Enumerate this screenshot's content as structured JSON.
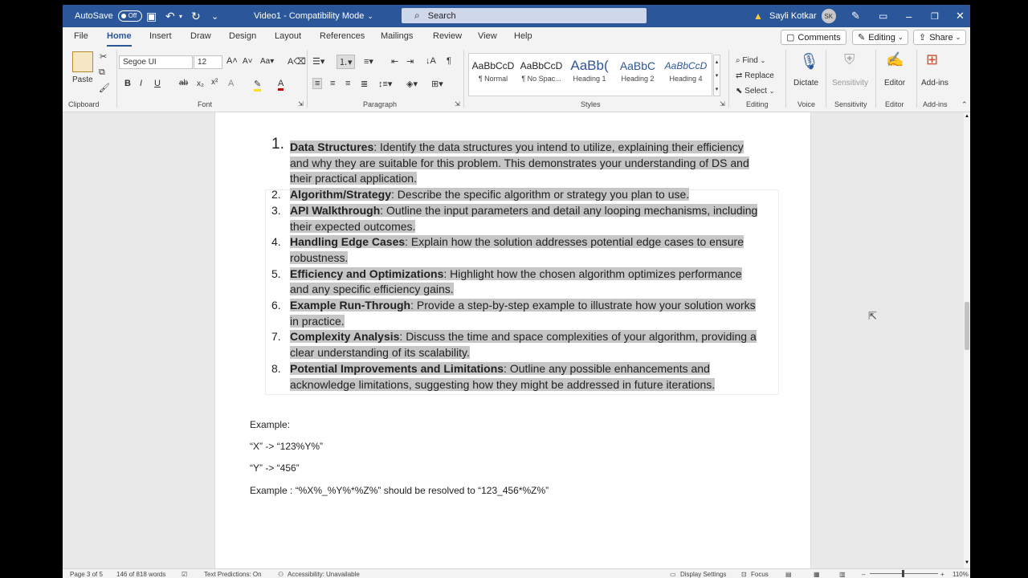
{
  "titlebar": {
    "autosave_label": "AutoSave",
    "autosave_state": "Off",
    "doc_title": "Video1 - Compatibility Mode",
    "search_placeholder": "Search",
    "user_name": "Sayli Kotkar",
    "user_initials": "SK"
  },
  "menu": {
    "tabs": [
      "File",
      "Home",
      "Insert",
      "Draw",
      "Design",
      "Layout",
      "References",
      "Mailings",
      "Review",
      "View",
      "Help"
    ],
    "active": "Home",
    "comments_label": "Comments",
    "editing_label": "Editing",
    "share_label": "Share"
  },
  "ribbon": {
    "clipboard": {
      "paste_label": "Paste",
      "group": "Clipboard"
    },
    "font": {
      "name": "Segoe UI",
      "size": "12",
      "group": "Font"
    },
    "paragraph": {
      "group": "Paragraph"
    },
    "styles": {
      "group": "Styles",
      "items": [
        {
          "preview": "AaBbCcD",
          "label": "¶ Normal"
        },
        {
          "preview": "AaBbCcD",
          "label": "¶ No Spac..."
        },
        {
          "preview": "AaBb(",
          "label": "Heading 1"
        },
        {
          "preview": "AaBbC",
          "label": "Heading 2"
        },
        {
          "preview": "AaBbCcD",
          "label": "Heading 4"
        }
      ]
    },
    "editing": {
      "find": "Find",
      "replace": "Replace",
      "select": "Select",
      "group": "Editing"
    },
    "voice": {
      "dictate": "Dictate",
      "group": "Voice"
    },
    "sensitivity": {
      "label": "Sensitivity",
      "group": "Sensitivity"
    },
    "editor": {
      "label": "Editor",
      "group": "Editor"
    },
    "addins": {
      "label": "Add-ins",
      "group": "Add-ins"
    }
  },
  "document": {
    "list": [
      {
        "num": "1.",
        "title": "Data Structures",
        "text": ": Identify the data structures you intend to utilize, explaining their efficiency and why they are suitable for this problem. This demonstrates your understanding of DS and their practical application."
      },
      {
        "num": "2.",
        "title": "Algorithm/Strategy",
        "text": ": Describe the specific algorithm or strategy you plan to use."
      },
      {
        "num": "3.",
        "title": "API Walkthrough",
        "text": ": Outline the input parameters and detail any looping mechanisms, including their expected outcomes."
      },
      {
        "num": "4.",
        "title": "Handling Edge Cases",
        "text": ": Explain how the solution addresses potential edge cases to ensure robustness."
      },
      {
        "num": "5.",
        "title": "Efficiency and Optimizations",
        "text": ": Highlight how the chosen algorithm optimizes performance and any specific efficiency gains."
      },
      {
        "num": "6.",
        "title": "Example Run-Through",
        "text": ": Provide a step-by-step example to illustrate how your solution works in practice."
      },
      {
        "num": "7.",
        "title": "Complexity Analysis",
        "text": ": Discuss the time and space complexities of your algorithm, providing a clear understanding of its scalability."
      },
      {
        "num": "8.",
        "title": "Potential Improvements and Limitations",
        "text": ": Outline any possible enhancements and acknowledge limitations, suggesting how they might be addressed in future iterations."
      }
    ],
    "example_heading": "Example:",
    "example_lines": [
      "“X” -> “123%Y%”",
      "“Y” -> “456”",
      "Example : “%X%_%Y%*%Z%” should be resolved to “123_456*%Z%”"
    ]
  },
  "statusbar": {
    "page": "Page 3 of 5",
    "words": "146 of 818 words",
    "text_predictions": "Text Predictions: On",
    "accessibility": "Accessibility: Unavailable",
    "display_settings": "Display Settings",
    "focus": "Focus",
    "zoom": "110%"
  },
  "colors": {
    "accent": "#2b579a",
    "highlight": "#c6c6c6"
  }
}
